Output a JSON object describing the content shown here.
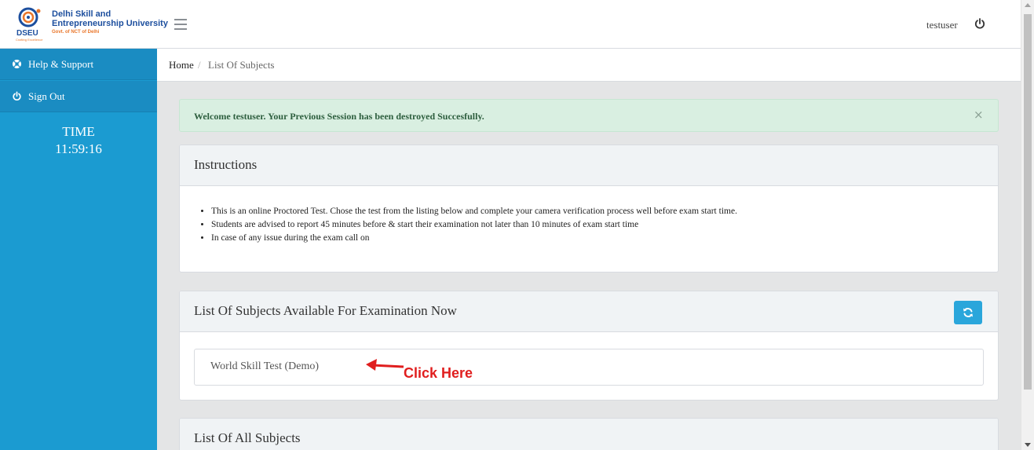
{
  "header": {
    "logo_text": "Delhi Skill and Entrepreneurship University",
    "logo_abbrev": "DSEU",
    "logo_gov": "Govt. of NCT of Delhi",
    "logo_tagline": "Crafting Excellence",
    "username": "testuser"
  },
  "sidebar": {
    "items": [
      {
        "label": "Help & Support",
        "icon": "lifebuoy-icon"
      },
      {
        "label": "Sign Out",
        "icon": "power-icon"
      }
    ],
    "timer_label": "TIME",
    "timer_value": "11:59:16"
  },
  "breadcrumb": {
    "home": "Home",
    "separator": "/",
    "current": "List Of Subjects"
  },
  "alert": {
    "message": "Welcome testuser. Your Previous Session has been destroyed Succesfully.",
    "close": "×"
  },
  "instructions": {
    "title": "Instructions",
    "items": [
      "This is an online Proctored Test. Chose the test from the listing below and complete your camera verification process well before exam start time.",
      "Students are advised to report 45 minutes before & start their examination not later than 10 minutes of exam start time",
      "In case of any issue during the exam call on"
    ]
  },
  "available": {
    "title": "List Of Subjects Available For Examination Now",
    "subjects": [
      "World Skill Test (Demo)"
    ],
    "annotation": "Click Here"
  },
  "all_subjects": {
    "title": "List Of All Subjects"
  },
  "colors": {
    "sidebar": "#1b9bd1",
    "accent": "#2aa6db",
    "alert_bg": "#d9efe1",
    "annotation": "#e01e1e"
  }
}
